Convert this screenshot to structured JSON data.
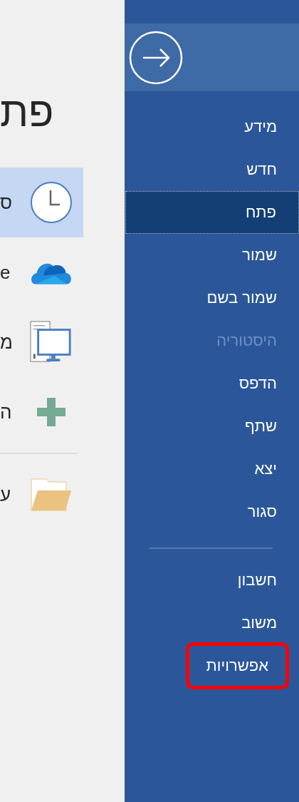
{
  "open_panel": {
    "title": "פת",
    "locations": [
      {
        "kind": "recent",
        "label": "ס",
        "selected": true
      },
      {
        "kind": "onedrive",
        "label": "e",
        "selected": false
      },
      {
        "kind": "computer",
        "label": "מ",
        "selected": false
      },
      {
        "kind": "add",
        "label": "ה",
        "selected": false
      },
      {
        "kind": "divider"
      },
      {
        "kind": "browse",
        "label": "ע",
        "selected": false
      }
    ]
  },
  "backstage_menu": {
    "items": [
      {
        "label": "מידע",
        "selected": false,
        "disabled": false,
        "highlighted": false
      },
      {
        "label": "חדש",
        "selected": false,
        "disabled": false,
        "highlighted": false
      },
      {
        "label": "פתח",
        "selected": true,
        "disabled": false,
        "highlighted": false
      },
      {
        "label": "שמור",
        "selected": false,
        "disabled": false,
        "highlighted": false
      },
      {
        "label": "שמור בשם",
        "selected": false,
        "disabled": false,
        "highlighted": false
      },
      {
        "label": "היסטוריה",
        "selected": false,
        "disabled": true,
        "highlighted": false
      },
      {
        "label": "הדפס",
        "selected": false,
        "disabled": false,
        "highlighted": false
      },
      {
        "label": "שתף",
        "selected": false,
        "disabled": false,
        "highlighted": false
      },
      {
        "label": "יצא",
        "selected": false,
        "disabled": false,
        "highlighted": false
      },
      {
        "label": "סגור",
        "selected": false,
        "disabled": false,
        "highlighted": false
      },
      {
        "kind": "divider"
      },
      {
        "label": "חשבון",
        "selected": false,
        "disabled": false,
        "highlighted": false
      },
      {
        "label": "משוב",
        "selected": false,
        "disabled": false,
        "highlighted": false
      },
      {
        "label": "אפשרויות",
        "selected": false,
        "disabled": false,
        "highlighted": true
      }
    ]
  }
}
